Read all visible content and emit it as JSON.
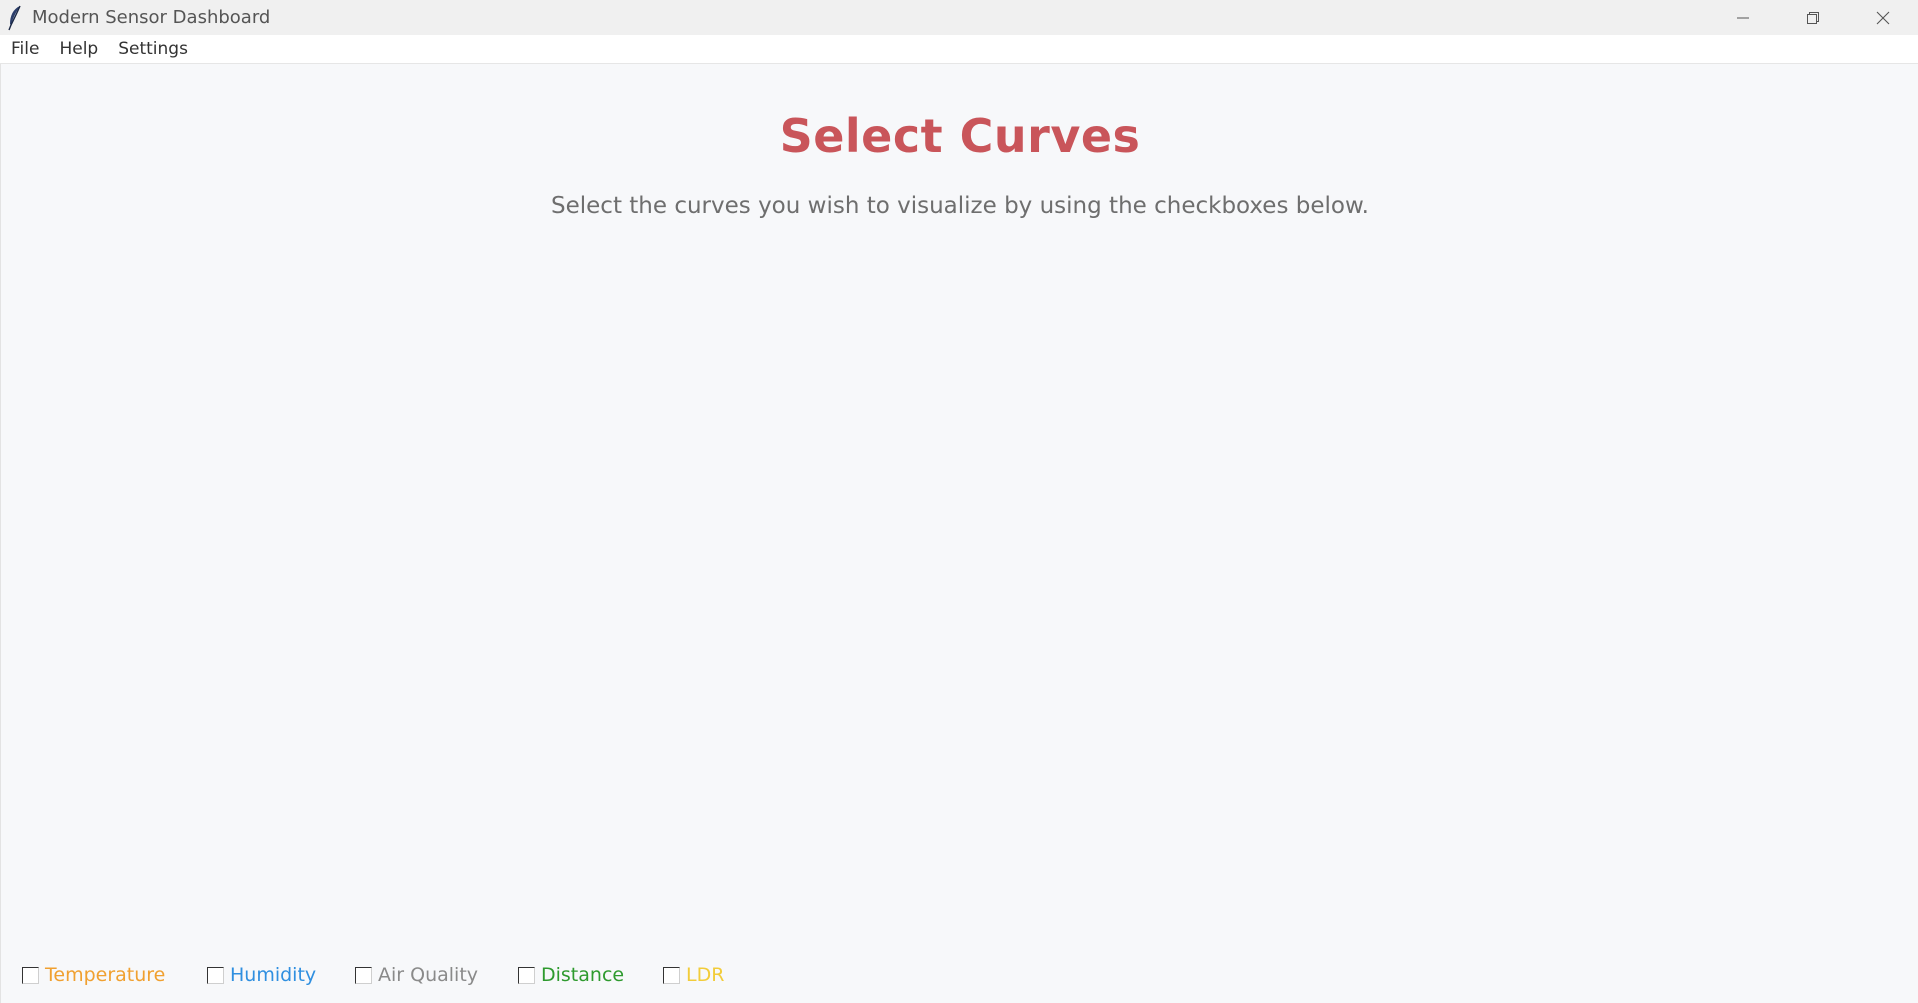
{
  "window": {
    "title": "Modern Sensor Dashboard",
    "app_icon": "feather-icon"
  },
  "menu": {
    "items": [
      {
        "label": "File"
      },
      {
        "label": "Help"
      },
      {
        "label": "Settings"
      }
    ]
  },
  "main": {
    "title": "Select Curves",
    "subtitle": "Select the curves you wish to visualize by using the checkboxes below.",
    "title_color": "#c9555a"
  },
  "curves": [
    {
      "label": "Temperature",
      "checked": false,
      "color": "#f0a030"
    },
    {
      "label": "Humidity",
      "checked": false,
      "color": "#2f8fe0"
    },
    {
      "label": "Air Quality",
      "checked": false,
      "color": "#8a8a8a"
    },
    {
      "label": "Distance",
      "checked": false,
      "color": "#2e9a2e"
    },
    {
      "label": "LDR",
      "checked": false,
      "color": "#f2cc3a"
    }
  ]
}
